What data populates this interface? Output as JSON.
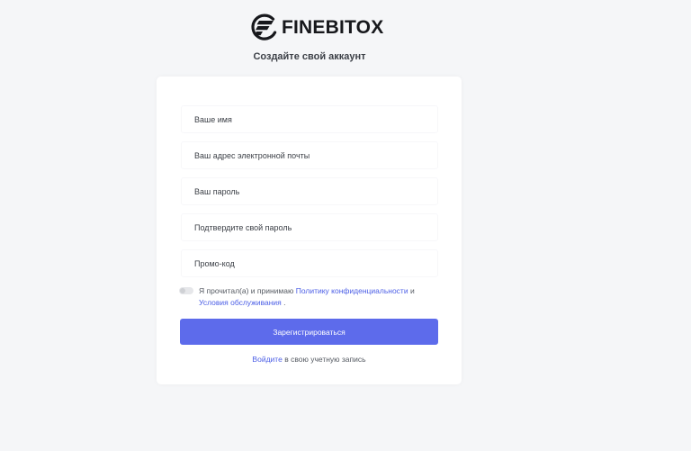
{
  "brand": {
    "name": "FINEBITOX"
  },
  "page": {
    "subtitle": "Создайте свой аккаунт"
  },
  "form": {
    "fields": [
      {
        "placeholder": "Ваше имя",
        "value": ""
      },
      {
        "placeholder": "Ваш адрес электронной почты",
        "value": ""
      },
      {
        "placeholder": "Ваш пароль",
        "value": ""
      },
      {
        "placeholder": "Подтвердите свой пароль",
        "value": ""
      },
      {
        "placeholder": "Промо-код",
        "value": ""
      }
    ],
    "agreement": {
      "prefix": "Я прочитал(а) и принимаю",
      "privacy_link": "Политику конфиденциальности",
      "conjunction": "и",
      "terms_link": "Условия обслуживания",
      "suffix": ".",
      "checked": false
    },
    "submit_label": "Зарегистрироваться",
    "login": {
      "link": "Войдите",
      "text": "в свою учетную запись"
    }
  },
  "colors": {
    "accent": "#5d6beb",
    "link": "#4b5ee6",
    "background": "#f5f6f8",
    "card": "#ffffff"
  },
  "icons": {
    "logo": "finebitox-logo-icon"
  }
}
